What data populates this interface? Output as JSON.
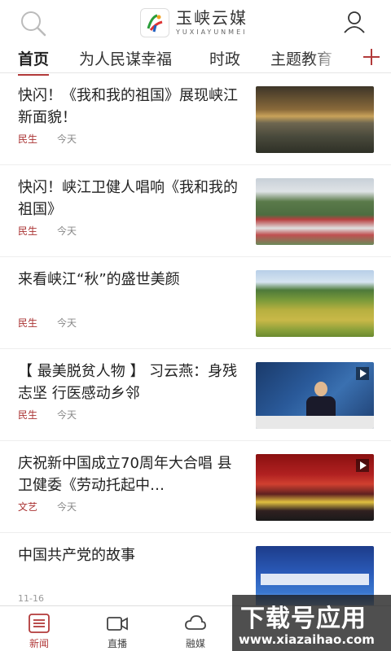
{
  "header": {
    "app_name": "玉峡云媒",
    "app_sub": "YUXIAYUNMEI"
  },
  "tabs": [
    {
      "label": "首页"
    },
    {
      "label": "为人民谋幸福"
    },
    {
      "label": "时政"
    },
    {
      "label": "主题教育"
    }
  ],
  "news": [
    {
      "title": "快闪！《我和我的祖国》展现峡江新面貌！",
      "category": "民生",
      "time": "今天",
      "video": false
    },
    {
      "title": "快闪！峡江卫健人唱响《我和我的祖国》",
      "category": "民生",
      "time": "今天",
      "video": false
    },
    {
      "title": "来看峡江“秋”的盛世美颜",
      "category": "民生",
      "time": "今天",
      "video": false
    },
    {
      "title": "【 最美脱贫人物 】  习云燕：身残志坚 行医感动乡邻",
      "category": "民生",
      "time": "今天",
      "video": true
    },
    {
      "title": "庆祝新中国成立70周年大合唱 县卫健委《劳动托起中…",
      "category": "文艺",
      "time": "今天",
      "video": true
    },
    {
      "title": "中国共产党的故事",
      "category": "",
      "time": "",
      "video": false
    }
  ],
  "bottom_date": "11-16",
  "bottom_nav": [
    {
      "label": "新闻"
    },
    {
      "label": "直播"
    },
    {
      "label": "融媒"
    }
  ],
  "watermark": {
    "big": "下载号应用",
    "url": "www.xiazaihao.com"
  },
  "colors": {
    "accent": "#b23a3a",
    "category": "#a33333"
  }
}
